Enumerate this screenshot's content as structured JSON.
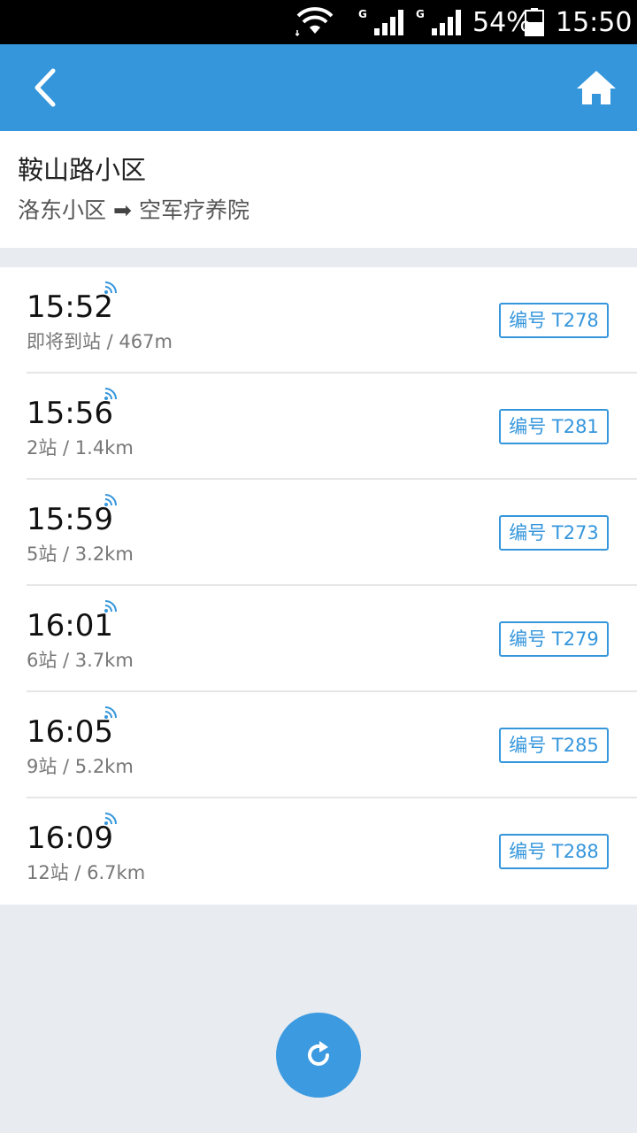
{
  "status_bar": {
    "battery": "54%",
    "time": "15:50",
    "network_1": "G",
    "network_2": "G"
  },
  "header": {
    "back_icon": "chevron-left-icon",
    "home_icon": "home-icon"
  },
  "route": {
    "stop_name": "鞍山路小区",
    "from": "洛东小区",
    "arrow": "➡",
    "to": "空军疗养院"
  },
  "arrivals": [
    {
      "time": "15:52",
      "info": "即将到站 / 467m",
      "bus": "编号 T278"
    },
    {
      "time": "15:56",
      "info": "2站 / 1.4km",
      "bus": "编号 T281"
    },
    {
      "time": "15:59",
      "info": "5站 / 3.2km",
      "bus": "编号 T273"
    },
    {
      "time": "16:01",
      "info": "6站 / 3.7km",
      "bus": "编号 T279"
    },
    {
      "time": "16:05",
      "info": "9站 / 5.2km",
      "bus": "编号 T285"
    },
    {
      "time": "16:09",
      "info": "12站 / 6.7km",
      "bus": "编号 T288"
    }
  ],
  "colors": {
    "primary": "#3596dc",
    "background": "#e8ebf0"
  },
  "refresh_icon": "refresh-icon"
}
